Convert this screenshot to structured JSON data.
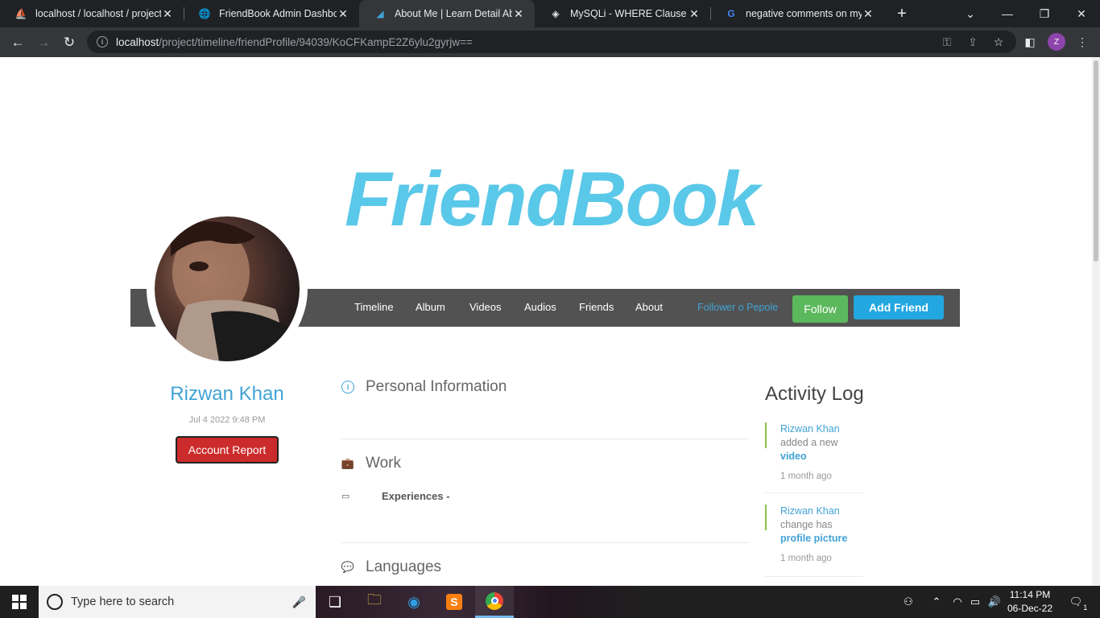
{
  "browser": {
    "tabs": [
      {
        "title": "localhost / localhost / project",
        "icon": "phpmyadmin-icon"
      },
      {
        "title": "FriendBook Admin Dashboard",
        "icon": "globe-icon"
      },
      {
        "title": "About Me | Learn Detail About",
        "icon": "friendbook-favicon-icon"
      },
      {
        "title": "MySQLi - WHERE Clause",
        "icon": "tutorialspoint-icon"
      },
      {
        "title": "negative comments on my post",
        "icon": "google-icon"
      }
    ],
    "active_tab_index": 2,
    "url_host": "localhost",
    "url_path": "/project/timeline/friendProfile/94039/KoCFKampE2Z6ylu2gyrjw==",
    "profile_initial": "Z"
  },
  "page": {
    "logo": "FriendBook",
    "nav": {
      "links": [
        "Timeline",
        "Album",
        "Videos",
        "Audios",
        "Friends",
        "About"
      ],
      "followers": "Follower o Pepole",
      "follow_label": "Follow",
      "add_friend_label": "Add Friend"
    },
    "profile": {
      "name": "Rizwan Khan",
      "joined": "Jul 4 2022 9:48 PM",
      "report_label": "Account Report"
    },
    "sections": {
      "personal": "Personal Information",
      "work": "Work",
      "experiences": "Experiences -",
      "languages": "Languages"
    },
    "activity": {
      "title": "Activity Log",
      "items": [
        {
          "user": "Rizwan Khan",
          "text": "added a new",
          "link": "video",
          "time": "1 month ago"
        },
        {
          "user": "Rizwan Khan",
          "text": "change has",
          "link": "profile picture",
          "time": "1 month ago"
        }
      ]
    }
  },
  "taskbar": {
    "search_placeholder": "Type here to search",
    "time": "11:14 PM",
    "date": "06-Dec-22",
    "notification_count": "1"
  },
  "colors": {
    "brand": "#5ac8e8",
    "link": "#41a3d6",
    "follow": "#5cb85c",
    "add_friend": "#23a7e0",
    "report": "#cc2b2b"
  }
}
